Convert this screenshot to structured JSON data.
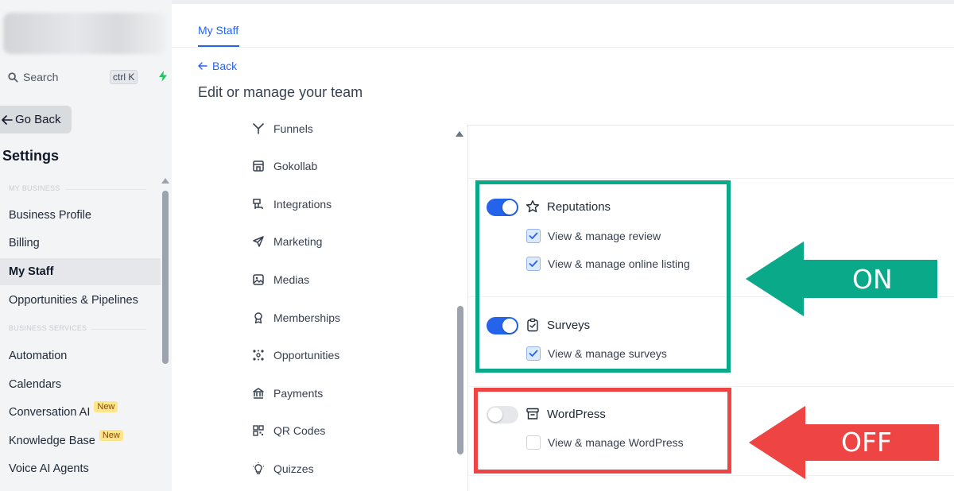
{
  "sidebar": {
    "search_label": "Search",
    "search_shortcut": "ctrl K",
    "go_back_label": "Go Back",
    "settings_title": "Settings",
    "section_my_business": "MY BUSINESS",
    "section_business_services": "BUSINESS SERVICES",
    "items": [
      {
        "label": "Business Profile"
      },
      {
        "label": "Billing"
      },
      {
        "label": "My Staff"
      },
      {
        "label": "Opportunities & Pipelines"
      },
      {
        "label": "Automation"
      },
      {
        "label": "Calendars"
      },
      {
        "label": "Conversation AI",
        "badge": "New"
      },
      {
        "label": "Knowledge Base",
        "badge": "New"
      },
      {
        "label": "Voice AI Agents"
      }
    ]
  },
  "main": {
    "tab_label": "My Staff",
    "back_label": "Back",
    "page_title": "Edit or manage your team",
    "modules": [
      {
        "label": "Funnels",
        "icon": "funnel-icon"
      },
      {
        "label": "Gokollab",
        "icon": "storefront-icon"
      },
      {
        "label": "Integrations",
        "icon": "integrations-icon"
      },
      {
        "label": "Marketing",
        "icon": "send-icon"
      },
      {
        "label": "Medias",
        "icon": "image-icon"
      },
      {
        "label": "Memberships",
        "icon": "award-icon"
      },
      {
        "label": "Opportunities",
        "icon": "opportunities-icon"
      },
      {
        "label": "Payments",
        "icon": "bank-icon"
      },
      {
        "label": "QR Codes",
        "icon": "qr-code-icon"
      },
      {
        "label": "Quizzes",
        "icon": "bulb-icon"
      }
    ],
    "permissions": {
      "reputations": {
        "title": "Reputations",
        "enabled": true,
        "subs": [
          {
            "label": "View & manage review",
            "checked": true
          },
          {
            "label": "View & manage online listing",
            "checked": true
          }
        ]
      },
      "surveys": {
        "title": "Surveys",
        "enabled": true,
        "subs": [
          {
            "label": "View & manage surveys",
            "checked": true
          }
        ]
      },
      "wordpress": {
        "title": "WordPress",
        "enabled": false,
        "subs": [
          {
            "label": "View & manage WordPress",
            "checked": false
          }
        ]
      }
    }
  },
  "annotations": {
    "on_label": "ON",
    "off_label": "OFF",
    "on_color": "#0aa989",
    "off_color": "#ef4444"
  },
  "colors": {
    "accent": "#2563eb",
    "sidebar_bg": "#f3f4f6",
    "badge_bg": "#fde68a"
  }
}
